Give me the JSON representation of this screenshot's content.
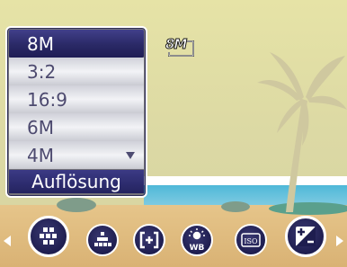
{
  "menu": {
    "items": [
      {
        "label": "8M",
        "selected": true
      },
      {
        "label": "3:2",
        "selected": false
      },
      {
        "label": "16:9",
        "selected": false
      },
      {
        "label": "6M",
        "selected": false
      },
      {
        "label": "4M",
        "selected": false
      }
    ],
    "title": "Auflösung"
  },
  "indicator": {
    "resolution": "8M"
  },
  "iconbar": {
    "icons": [
      "resolution-icon",
      "quality-icon",
      "focus-frame-icon",
      "white-balance-icon",
      "iso-icon",
      "exposure-compensation-icon"
    ],
    "wb_text": "WB",
    "iso_text": "ISO"
  },
  "colors": {
    "menu_selected": "#2a2966",
    "menu_option": "#e6e7ec",
    "menu_text": "#4d4a6f",
    "title_bar": "#2f2e72"
  }
}
